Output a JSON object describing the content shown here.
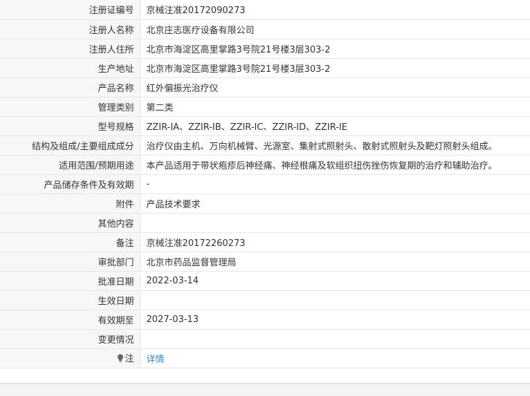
{
  "rows": [
    {
      "label": "注册证编号",
      "value": "京械注准20172090273"
    },
    {
      "label": "注册人名称",
      "value": "北京庄志医疗设备有限公司"
    },
    {
      "label": "注册人住所",
      "value": "北京市海淀区高里掌路3号院21号楼3层303-2"
    },
    {
      "label": "生产地址",
      "value": "北京市海淀区高里掌路3号院21号楼3层303-2"
    },
    {
      "label": "产品名称",
      "value": "红外偏振光治疗仪"
    },
    {
      "label": "管理类别",
      "value": "第二类"
    },
    {
      "label": "型号规格",
      "value": "ZZIR-IA、ZZIR-IB、ZZIR-IC、ZZIR-ID、ZZIR-IE"
    },
    {
      "label": "结构及组成/主要组成成分",
      "value": "治疗仪由主机、万向机械臂、光源室、集射式照射头、散射式照射头及靶灯照射头组成。"
    },
    {
      "label": "适用范围/预期用途",
      "value": "本产品适用于带状疱疹后神经痛、神经根痛及软组织扭伤挫伤恢复期的治疗和辅助治疗。"
    },
    {
      "label": "产品储存条件及有效期",
      "value": "-"
    },
    {
      "label": "附件",
      "value": "产品技术要求"
    },
    {
      "label": "其他内容",
      "value": ""
    },
    {
      "label": "备注",
      "value": "京械注准20172260273"
    },
    {
      "label": "审批部门",
      "value": "北京市药品监督管理局"
    },
    {
      "label": "批准日期",
      "value": "2022-03-14"
    },
    {
      "label": "生效日期",
      "value": ""
    },
    {
      "label": "有效期至",
      "value": "2027-03-13"
    },
    {
      "label": "变更情况",
      "value": ""
    }
  ],
  "note": {
    "label": "注",
    "icon": "lightbulb-icon",
    "link_text": "详情"
  },
  "colors": {
    "label_bg": "#f7f7f7",
    "border": "#e6e6e6",
    "link": "#3a87c8"
  }
}
